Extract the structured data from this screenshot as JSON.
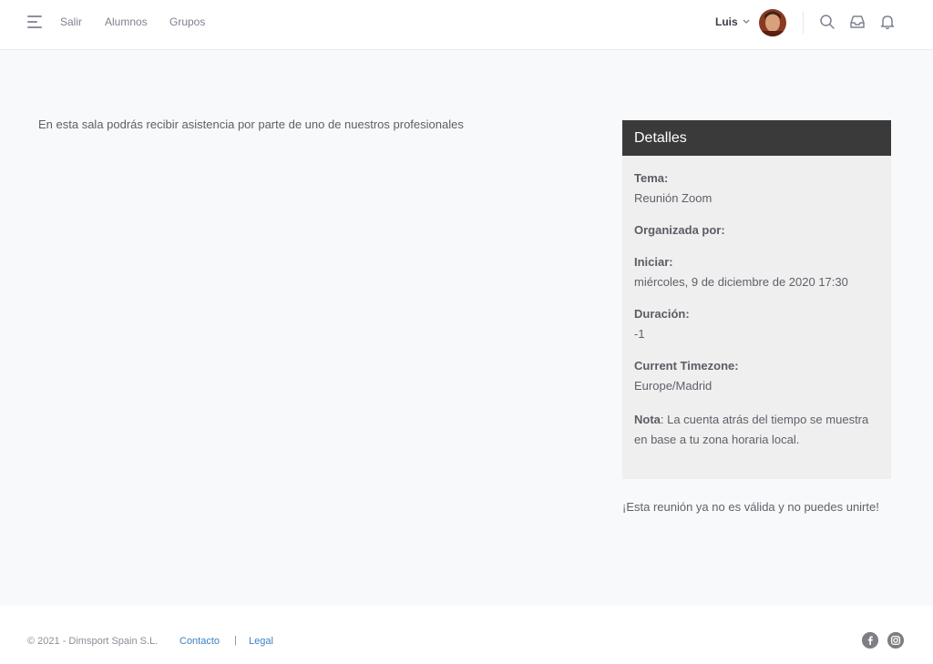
{
  "nav": {
    "items": [
      {
        "label": "Salir"
      },
      {
        "label": "Alumnos"
      },
      {
        "label": "Grupos"
      }
    ],
    "user_name": "Luis",
    "icons": [
      "menu-icon",
      "search-icon",
      "inbox-icon",
      "bell-icon",
      "chevron-down-icon"
    ]
  },
  "main": {
    "intro": "En esta sala podrás recibir asistencia por parte de uno de nuestros profesionales"
  },
  "details": {
    "title": "Detalles",
    "topic_label": "Tema:",
    "topic_value": "Reunión Zoom",
    "host_label": "Organizada por:",
    "start_label": "Iniciar:",
    "start_value": "miércoles, 9 de diciembre de 2020 17:30",
    "duration_label": "Duración:",
    "duration_value": "-1",
    "timezone_label": "Current Timezone:",
    "timezone_value": "Europe/Madrid",
    "note_label": "Nota",
    "note_text": ": La cuenta atrás del tiempo se muestra en base a tu zona horaria local."
  },
  "status": {
    "message": "¡Esta reunión ya no es válida y no puedes unirte!"
  },
  "footer": {
    "copyright": "©  2021 - Dimsport Spain S.L.",
    "contact_label": "Contacto",
    "separator": "|",
    "legal_label": "Legal",
    "social": [
      "facebook-icon",
      "instagram-icon"
    ]
  },
  "colors": {
    "header_dark": "#3a3a3a",
    "panel_bg": "#efefef",
    "link_blue": "#3b82c4",
    "page_bg": "#f8f9fb"
  }
}
